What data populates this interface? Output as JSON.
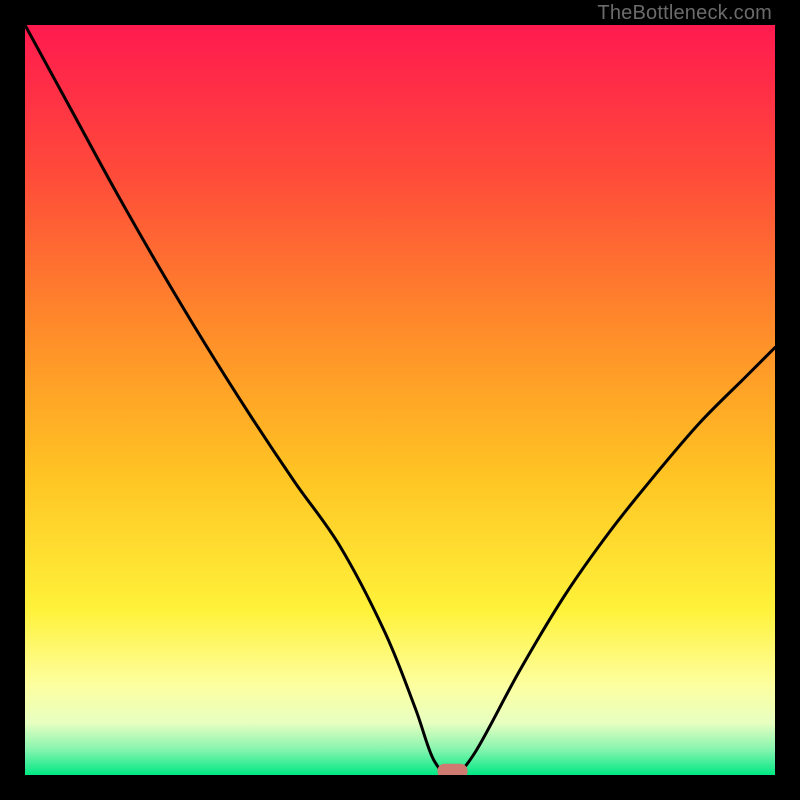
{
  "watermark": "TheBottleneck.com",
  "chart_data": {
    "type": "line",
    "title": "",
    "xlabel": "",
    "ylabel": "",
    "xlim": [
      0,
      100
    ],
    "ylim": [
      0,
      100
    ],
    "grid": false,
    "legend": false,
    "background": "vertical-gradient red→orange→yellow→green",
    "series": [
      {
        "name": "bottleneck-curve",
        "x": [
          0,
          6,
          12,
          18,
          24,
          30,
          36,
          42,
          48,
          52,
          54.5,
          57,
          60,
          66,
          72,
          78,
          84,
          90,
          96,
          100
        ],
        "y": [
          100,
          89,
          78,
          67.5,
          57.5,
          48,
          39,
          30.5,
          19,
          9,
          2,
          0,
          3,
          14,
          24,
          32.5,
          40,
          47,
          53,
          57
        ]
      }
    ],
    "marker": {
      "name": "optimum-marker",
      "x": 57,
      "y": 0.5,
      "color": "#cf7a70",
      "shape": "rounded-rect"
    },
    "gradient_stops": [
      {
        "offset": 0.0,
        "color": "#ff1a4f"
      },
      {
        "offset": 0.2,
        "color": "#ff4b3a"
      },
      {
        "offset": 0.4,
        "color": "#ff8a2a"
      },
      {
        "offset": 0.6,
        "color": "#ffc423"
      },
      {
        "offset": 0.78,
        "color": "#fff23a"
      },
      {
        "offset": 0.88,
        "color": "#fdffa0"
      },
      {
        "offset": 0.93,
        "color": "#e8ffc0"
      },
      {
        "offset": 0.965,
        "color": "#8af5b0"
      },
      {
        "offset": 1.0,
        "color": "#00e884"
      }
    ]
  }
}
